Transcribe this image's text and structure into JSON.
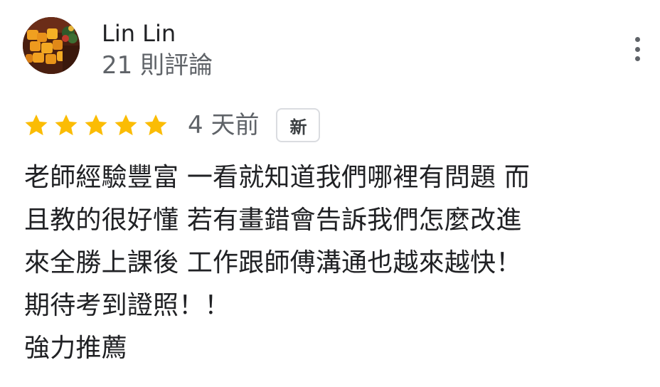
{
  "reviewer": {
    "name": "Lin Lin",
    "review_count": "21 則評論",
    "avatar_icon": "avatar-food-photo"
  },
  "more_menu_icon": "more-vert-icon",
  "review": {
    "rating": 5,
    "rating_max": 5,
    "star_color": "#fbbc04",
    "date": "4 天前",
    "badge": "新",
    "lines": [
      "老師經驗豐富 一看就知道我們哪裡有問題 而",
      "且教的很好懂 若有畫錯會告訴我們怎麼改進",
      "來全勝上課後 工作跟師傅溝通也越來越快！",
      "期待考到證照！！",
      "強力推薦"
    ]
  }
}
